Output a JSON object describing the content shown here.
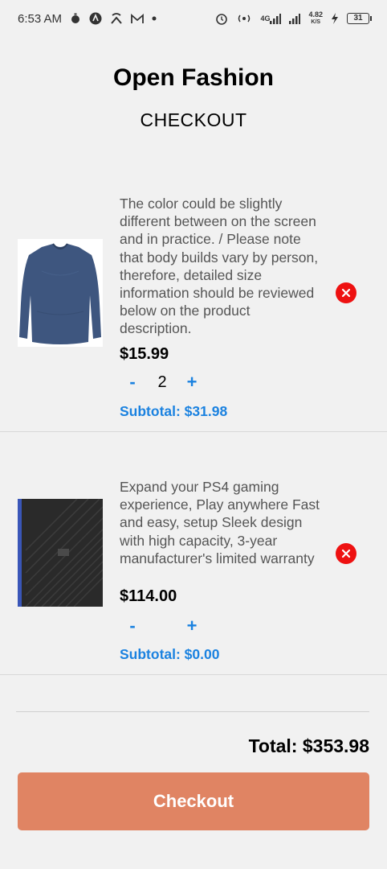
{
  "status_bar": {
    "time": "6:53 AM",
    "left_icons": [
      "timer-icon",
      "autofill-icon",
      "network-share-icon",
      "gmail-icon",
      "dot-icon"
    ],
    "network_label": "4G",
    "speed_value": "4.82",
    "speed_unit": "K/S",
    "battery_level": "31"
  },
  "header": {
    "app_title": "Open Fashion",
    "page_title": "CHECKOUT"
  },
  "cart": {
    "items": [
      {
        "description": "The color could be slightly different between on the screen and in practice. / Please note that body builds vary by person, therefore, detailed size information should be reviewed below on the product description.",
        "price": "$15.99",
        "quantity": "2",
        "subtotal": "Subtotal: $31.98",
        "minus_label": "-",
        "plus_label": "+"
      },
      {
        "description": "Expand your PS4 gaming experience, Play anywhere Fast and easy, setup Sleek design with high capacity, 3-year manufacturer's limited warranty",
        "price": "$114.00",
        "quantity": "",
        "subtotal": "Subtotal: $0.00",
        "minus_label": "-",
        "plus_label": "+"
      }
    ]
  },
  "footer": {
    "total": "Total: $353.98",
    "checkout_label": "Checkout"
  },
  "colors": {
    "accent_blue": "#1b82e0",
    "checkout_button": "#e08463",
    "remove_red": "#ee1111",
    "background": "#f1f1f1"
  }
}
